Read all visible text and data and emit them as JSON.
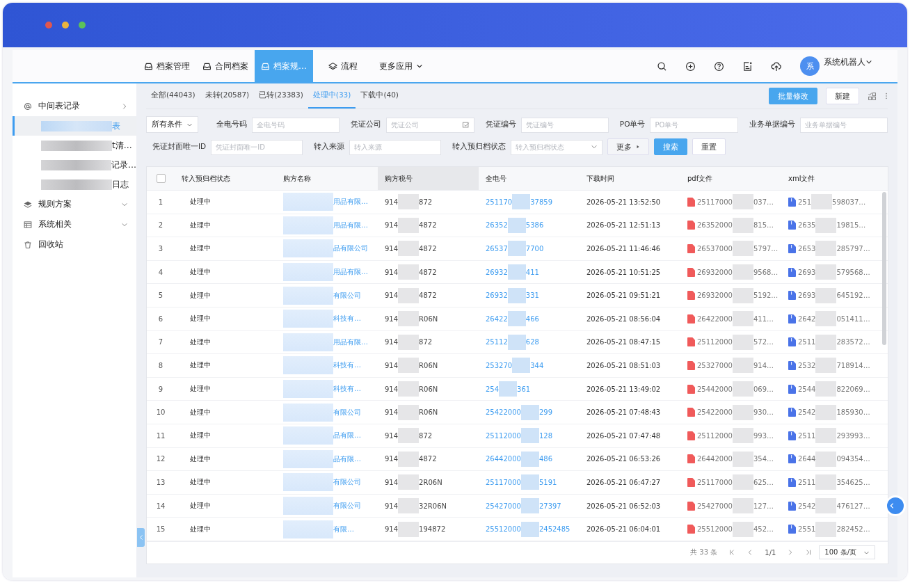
{
  "nav": {
    "items": [
      {
        "label": "档案管理",
        "kind": "tray",
        "selected": false
      },
      {
        "label": "合同档案",
        "kind": "tray",
        "selected": false
      },
      {
        "label": "档案规…",
        "kind": "tray",
        "selected": true
      },
      {
        "label": "流程",
        "kind": "layers",
        "selected": false
      },
      {
        "label": "更多应用",
        "kind": "dropdown",
        "selected": false
      }
    ],
    "user": {
      "avatar": "系",
      "name": "系统机器人"
    }
  },
  "sidebar": {
    "items": [
      {
        "label": "中间表记录",
        "expanded": true,
        "children": [
          {
            "label": "表",
            "selected": true
          },
          {
            "label": "t清…",
            "selected": false
          },
          {
            "label": "记录…",
            "selected": false
          },
          {
            "label": "日志",
            "selected": false
          }
        ]
      },
      {
        "label": "规则方案",
        "expanded": false
      },
      {
        "label": "系统相关",
        "expanded": false
      },
      {
        "label": "回收站"
      }
    ]
  },
  "tabs": [
    {
      "label": "全部(44043)",
      "selected": false
    },
    {
      "label": "未转(20587)",
      "selected": false
    },
    {
      "label": "已转(23383)",
      "selected": false
    },
    {
      "label": "处理中(33)",
      "selected": true
    },
    {
      "label": "下载中(40)",
      "selected": false
    }
  ],
  "actions": {
    "primary": "批量修改",
    "secondary": "新建"
  },
  "filters": {
    "condition": "所有条件",
    "row1": [
      {
        "label": "全电号码",
        "placeholder": "全电号码",
        "kind": "text"
      },
      {
        "label": "凭证公司",
        "placeholder": "凭证公司",
        "kind": "picker"
      },
      {
        "label": "凭证编号",
        "placeholder": "凭证编号",
        "kind": "text"
      },
      {
        "label": "PO单号",
        "placeholder": "PO单号",
        "kind": "text"
      },
      {
        "label": "业务单据编号",
        "placeholder": "业务单据编号",
        "kind": "text"
      }
    ],
    "row2": [
      {
        "label": "凭证封面唯一ID",
        "placeholder": "凭证封面唯一ID",
        "kind": "text"
      },
      {
        "label": "转入来源",
        "placeholder": "转入来源",
        "kind": "text"
      },
      {
        "label": "转入预归档状态",
        "placeholder": "转入预归档状态",
        "kind": "select"
      }
    ],
    "more": "更多",
    "search": "搜索",
    "reset": "重置"
  },
  "table": {
    "select_all_checked": false,
    "columns": [
      "转入预归档状态",
      "购方名称",
      "购方税号",
      "全电号",
      "下载时间",
      "pdf文件",
      "xml文件"
    ],
    "rows": [
      {
        "no": "1",
        "status": "处理中",
        "buyer": "用品有限…",
        "tax_prefix": "914",
        "tax_suffix": "872",
        "invoice_prefix": "251170",
        "invoice_suffix": "37859",
        "time": "2026-05-21 13:52:50",
        "pdf_prefix": "25117000",
        "pdf_suffix": "037…",
        "xml_prefix": "251",
        "xml_suffix": "598037…"
      },
      {
        "no": "2",
        "status": "处理中",
        "buyer": "用品有限…",
        "tax_prefix": "914",
        "tax_suffix": "4872",
        "invoice_prefix": "26352",
        "invoice_suffix": "5386",
        "time": "2026-05-21 12:51:13",
        "pdf_prefix": "26352000",
        "pdf_suffix": "815…",
        "xml_prefix": "2635",
        "xml_suffix": "19815…"
      },
      {
        "no": "3",
        "status": "处理中",
        "buyer": "品有限公司",
        "tax_prefix": "914",
        "tax_suffix": "4872",
        "invoice_prefix": "26537",
        "invoice_suffix": "7700",
        "time": "2026-05-21 11:46:46",
        "pdf_prefix": "26537000",
        "pdf_suffix": "5797…",
        "xml_prefix": "2653",
        "xml_suffix": "285797…"
      },
      {
        "no": "4",
        "status": "处理中",
        "buyer": "用品有限…",
        "tax_prefix": "914",
        "tax_suffix": "4872",
        "invoice_prefix": "26932",
        "invoice_suffix": "411",
        "time": "2026-05-21 10:51:25",
        "pdf_prefix": "26932000",
        "pdf_suffix": "9568…",
        "xml_prefix": "2693",
        "xml_suffix": "579568…"
      },
      {
        "no": "5",
        "status": "处理中",
        "buyer": "有限公司",
        "tax_prefix": "914",
        "tax_suffix": "4872",
        "invoice_prefix": "26932",
        "invoice_suffix": "331",
        "time": "2026-05-21 09:51:21",
        "pdf_prefix": "26932000",
        "pdf_suffix": "5192…",
        "xml_prefix": "2693",
        "xml_suffix": "645192…"
      },
      {
        "no": "6",
        "status": "处理中",
        "buyer": "科技有…",
        "tax_prefix": "914",
        "tax_suffix": "R06N",
        "invoice_prefix": "26422",
        "invoice_suffix": "466",
        "time": "2026-05-21 08:56:04",
        "pdf_prefix": "26422000",
        "pdf_suffix": "411…",
        "xml_prefix": "2642",
        "xml_suffix": "051411…"
      },
      {
        "no": "7",
        "status": "处理中",
        "buyer": "用品有限…",
        "tax_prefix": "914",
        "tax_suffix": "872",
        "invoice_prefix": "25112",
        "invoice_suffix": "628",
        "time": "2026-05-21 08:47:15",
        "pdf_prefix": "25112000",
        "pdf_suffix": "572…",
        "xml_prefix": "2511",
        "xml_suffix": "283572…"
      },
      {
        "no": "8",
        "status": "处理中",
        "buyer": "科技有…",
        "tax_prefix": "914",
        "tax_suffix": "R06N",
        "invoice_prefix": "253270",
        "invoice_suffix": "344",
        "time": "2026-05-21 08:51:03",
        "pdf_prefix": "25327000",
        "pdf_suffix": "914…",
        "xml_prefix": "2532",
        "xml_suffix": "718914…"
      },
      {
        "no": "9",
        "status": "处理中",
        "buyer": "科技有…",
        "tax_prefix": "914",
        "tax_suffix": "R06N",
        "invoice_prefix": "254",
        "invoice_suffix": "361",
        "time": "2026-05-21 13:49:02",
        "pdf_prefix": "25442000",
        "pdf_suffix": "069…",
        "xml_prefix": "2544",
        "xml_suffix": "822069…"
      },
      {
        "no": "10",
        "status": "处理中",
        "buyer": "有限公司",
        "tax_prefix": "914",
        "tax_suffix": "R06N",
        "invoice_prefix": "25422000",
        "invoice_suffix": "299",
        "time": "2026-05-21 07:48:43",
        "pdf_prefix": "25422000",
        "pdf_suffix": "930…",
        "xml_prefix": "2542",
        "xml_suffix": "185930…"
      },
      {
        "no": "11",
        "status": "处理中",
        "buyer": "品有限…",
        "tax_prefix": "914",
        "tax_suffix": "872",
        "invoice_prefix": "25112000",
        "invoice_suffix": "128",
        "time": "2026-05-21 07:47:48",
        "pdf_prefix": "25112000",
        "pdf_suffix": "993…",
        "xml_prefix": "2511",
        "xml_suffix": "293993…"
      },
      {
        "no": "12",
        "status": "处理中",
        "buyer": "品有限…",
        "tax_prefix": "914",
        "tax_suffix": "4872",
        "invoice_prefix": "26442000",
        "invoice_suffix": "486",
        "time": "2026-05-21 06:53:26",
        "pdf_prefix": "26442000",
        "pdf_suffix": "354…",
        "xml_prefix": "2644",
        "xml_suffix": "094354…"
      },
      {
        "no": "13",
        "status": "处理中",
        "buyer": "有限公司",
        "tax_prefix": "914",
        "tax_suffix": "2R06N",
        "invoice_prefix": "25117000",
        "invoice_suffix": "5191",
        "time": "2026-05-21 06:47:27",
        "pdf_prefix": "25117000",
        "pdf_suffix": "625…",
        "xml_prefix": "2511",
        "xml_suffix": "354625…"
      },
      {
        "no": "14",
        "status": "处理中",
        "buyer": "有限公司",
        "tax_prefix": "914",
        "tax_suffix": "32R06N",
        "invoice_prefix": "25427000",
        "invoice_suffix": "27397",
        "time": "2026-05-21 06:52:03",
        "pdf_prefix": "25427000",
        "pdf_suffix": "127…",
        "xml_prefix": "2542",
        "xml_suffix": "476127…"
      },
      {
        "no": "15",
        "status": "处理中",
        "buyer": "有限…",
        "tax_prefix": "914",
        "tax_suffix": "194872",
        "invoice_prefix": "25512000",
        "invoice_suffix": "2452485",
        "time": "2026-05-21 06:04:01",
        "pdf_prefix": "25512000",
        "pdf_suffix": "452…",
        "xml_prefix": "2551",
        "xml_suffix": "282452…"
      }
    ]
  },
  "pagination": {
    "total": "共 33 条",
    "page": "1/1",
    "page_size": "100 条/页"
  }
}
